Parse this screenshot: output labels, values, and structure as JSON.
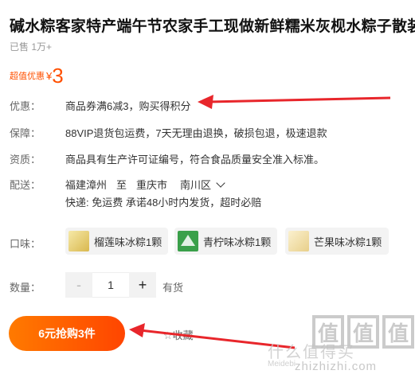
{
  "product": {
    "title": "碱水粽客家特产端午节农家手工现做新鲜糯米灰枧水粽子散装",
    "sold": "已售 1万+"
  },
  "price": {
    "tag": "超值优惠",
    "symbol": "¥",
    "value": "3"
  },
  "promo": {
    "label": "优惠：",
    "text": "商品券满6减3，购买得积分"
  },
  "guarantee": {
    "label": "保障：",
    "text": "88VIP退货包运费，7天无理由退换，破损包退，极速退款"
  },
  "qualification": {
    "label": "资质：",
    "text": "商品具有生产许可证编号，符合食品质量安全准入标准。"
  },
  "shipping": {
    "label": "配送：",
    "from": "福建漳州",
    "to_word": "至",
    "city": "重庆市",
    "district": "南川区",
    "detail": "快递: 免运费  承诺48小时内发货，超时必赔"
  },
  "flavor": {
    "label": "口味：",
    "options": [
      {
        "label": "榴莲味冰粽1颗",
        "thumb_color": "#e9d37a"
      },
      {
        "label": "青柠味冰粽1颗",
        "thumb_color": "#3aa04a"
      },
      {
        "label": "芒果味冰粽1颗",
        "thumb_color": "#f1e3b8"
      }
    ]
  },
  "quantity": {
    "label": "数量：",
    "minus": "-",
    "value": "1",
    "plus": "+",
    "stock": "有货"
  },
  "actions": {
    "buy_label": "6元抢购3件",
    "favorite_label": "收藏"
  },
  "watermark": {
    "text1": "什么值得买",
    "chars": [
      "值",
      "值",
      "值"
    ],
    "text2": "zhizhizhi.com",
    "text3": "Meidebi"
  },
  "colors": {
    "accent": "#ff5000",
    "arrow": "#e8262b"
  }
}
